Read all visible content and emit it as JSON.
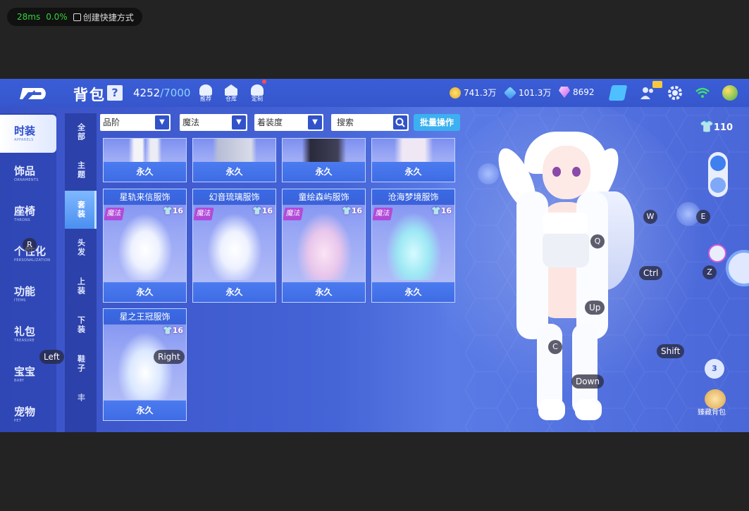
{
  "overlay": {
    "latency": "28ms",
    "loss": "0.0%",
    "shortcut": "创建快捷方式"
  },
  "header": {
    "title": "背包",
    "help": "?",
    "capacity_used": "4252",
    "capacity_max": "/7000",
    "tools": [
      {
        "label": "推荐",
        "icon": "lightbulb-icon"
      },
      {
        "label": "仓库",
        "icon": "house-icon"
      },
      {
        "label": "定制",
        "icon": "custom-icon"
      }
    ],
    "currencies": [
      {
        "value": "741.3万",
        "color": "#f2c23a"
      },
      {
        "value": "101.3万",
        "color": "#4fb0ff"
      },
      {
        "value": "8692",
        "color": "#e26bff"
      }
    ]
  },
  "sidebar": {
    "items": [
      {
        "cn": "时装",
        "en": "APPARELS"
      },
      {
        "cn": "饰品",
        "en": "ORNAMENTS"
      },
      {
        "cn": "座椅",
        "en": "THRONS"
      },
      {
        "cn": "个性化",
        "en": "PERSONALIZATION"
      },
      {
        "cn": "功能",
        "en": "ITEMS"
      },
      {
        "cn": "礼包",
        "en": "TREASURE"
      },
      {
        "cn": "宝宝",
        "en": "BABY"
      },
      {
        "cn": "宠物",
        "en": "PET"
      }
    ]
  },
  "subtabs": [
    "全部",
    "主题",
    "套装",
    "头发",
    "上装",
    "下装",
    "鞋子",
    "丰"
  ],
  "filters": {
    "grade": "品阶",
    "magic": "魔法",
    "wearing": "着装度",
    "search_placeholder": "搜索",
    "batch": "批量操作"
  },
  "cards_top": [
    {
      "duration": "永久"
    },
    {
      "duration": "永久"
    },
    {
      "duration": "永久"
    },
    {
      "duration": "永久"
    }
  ],
  "cards": [
    {
      "name": "星轨来信服饰",
      "tag": "魔法",
      "level": "16",
      "duration": "永久"
    },
    {
      "name": "幻音琉璃服饰",
      "tag": "魔法",
      "level": "16",
      "duration": "永久"
    },
    {
      "name": "童绘森屿服饰",
      "tag": "魔法",
      "level": "16",
      "duration": "永久"
    },
    {
      "name": "沧海梦境服饰",
      "tag": "魔法",
      "level": "16",
      "duration": "永久"
    },
    {
      "name": "星之王冠服饰",
      "tag": "",
      "level": "16",
      "duration": "永久"
    }
  ],
  "keys": {
    "w": "W",
    "e": "E",
    "q": "Q",
    "ctrl": "Ctrl",
    "z": "Z",
    "up": "Up",
    "c": "C",
    "shift": "Shift",
    "down": "Down",
    "left": "Left",
    "right": "Right",
    "r": "R"
  },
  "right": {
    "level": "110",
    "badge": "3",
    "collection": "臻藏背包"
  }
}
